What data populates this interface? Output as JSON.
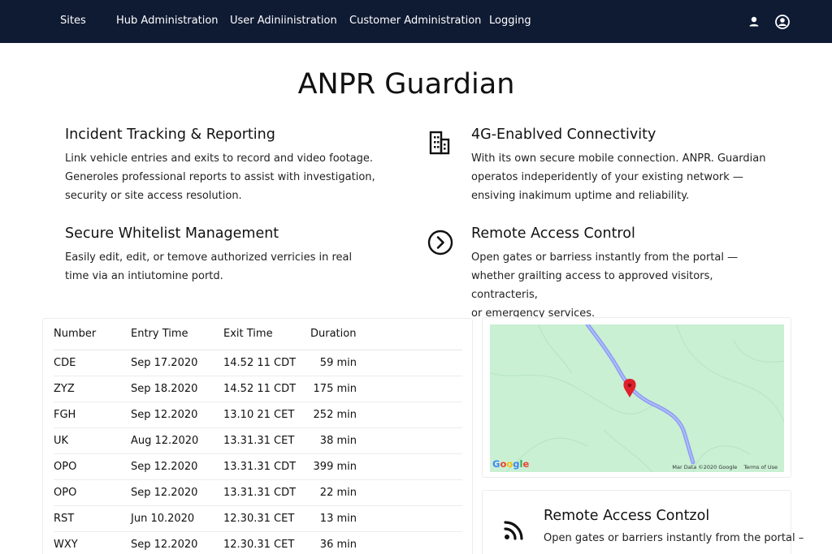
{
  "colors": {
    "navbar_bg": "#0f1a33",
    "map_land": "#c9f0d3",
    "map_river": "#8e9ff5",
    "marker": "#e0202a"
  },
  "nav": {
    "links": [
      "Sites",
      "Hub Administration",
      "User Adiniinistration",
      "Customer Administration",
      "Logging"
    ],
    "icons": [
      "person-icon",
      "account-circle-icon"
    ]
  },
  "page": {
    "title": "ANPR Guardian"
  },
  "features": [
    {
      "title": "Incident Tracking & Reporting",
      "icon": "",
      "lines": [
        "Link vehicle entries and exits to record and video footage.",
        "Generoles professional reports to assist with investigation,",
        "security or site access resolution."
      ]
    },
    {
      "title": "4G-Enablved Connectivity",
      "icon": "building-icon",
      "lines": [
        "With its own secure mobile connection. ANPR. Guardian",
        "operatos indeperidently of your existing network —",
        "ensiving inakimum uptime and reliability."
      ]
    },
    {
      "title": "Secure Whitelist Management",
      "icon": "",
      "lines": [
        "Easily edit, edit, or temove authorized verricies in real",
        "time via an intiutomine portd."
      ]
    },
    {
      "title": "Remote Access Control",
      "icon": "chevron-circle-icon",
      "lines": [
        "Open gates or barriess instantly from the portal —",
        "whether grailting access to approved visitors, contracteris,",
        "or emergency services."
      ]
    }
  ],
  "table": {
    "headers": [
      "Number",
      "Entry Time",
      "Exit Time",
      "Duration"
    ],
    "rows": [
      [
        "CDE",
        "Sep 17.2020",
        "14.52 11 CDT",
        "59 min"
      ],
      [
        "ZYZ",
        "Sep 18.2020",
        "14.52 11 CDT",
        "175 min"
      ],
      [
        "FGH",
        "Sep 12.2020",
        "13.10 21 CET",
        "252 min"
      ],
      [
        "UK",
        "Aug 12.2020",
        "13.31.31 CET",
        "38 min"
      ],
      [
        "OPO",
        "Sep 12.2020",
        "13.31.31 CDT",
        "399 min"
      ],
      [
        "OPO",
        "Sep 12.2020",
        "13.31.31 CDT",
        "22 min"
      ],
      [
        "RST",
        "Jun 10.2020",
        "12.30.31 CET",
        "13 min"
      ],
      [
        "WXY",
        "Sep 12.2020",
        "12.30.31 CET",
        "36 min"
      ]
    ]
  },
  "map": {
    "logo": "Google",
    "attribution": "Mar Data ©2020 Google",
    "terms": "Terms of Use"
  },
  "remote_card": {
    "title": "Remote Access Contzol",
    "text": "Open gates or barriers instantly from the portal –",
    "icon": "rss-icon"
  }
}
